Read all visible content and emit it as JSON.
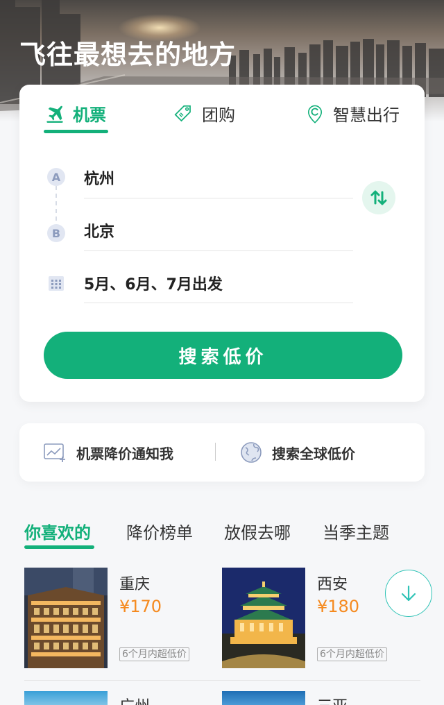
{
  "hero": {
    "title": "飞往最想去的地方"
  },
  "tabs": [
    {
      "label": "机票",
      "icon": "plane-icon"
    },
    {
      "label": "团购",
      "icon": "tag-icon"
    },
    {
      "label": "智慧出行",
      "icon": "location-icon"
    }
  ],
  "search": {
    "from_marker": "A",
    "to_marker": "B",
    "from": "杭州",
    "to": "北京",
    "date": "5月、6月、7月出发",
    "button_label": "搜索低价"
  },
  "quick_actions": [
    {
      "label": "机票降价通知我",
      "icon": "price-chart-icon"
    },
    {
      "label": "搜索全球低价",
      "icon": "globe-icon"
    }
  ],
  "recommend_tabs": [
    "你喜欢的",
    "降价榜单",
    "放假去哪",
    "当季主题"
  ],
  "destinations": [
    {
      "city": "重庆",
      "price": "¥170",
      "tag": "6个月内超低价"
    },
    {
      "city": "西安",
      "price": "¥180",
      "tag": "6个月内超低价"
    },
    {
      "city": "广州"
    },
    {
      "city": "三亚"
    }
  ],
  "colors": {
    "accent": "#13b07a",
    "price": "#f58a1f"
  }
}
